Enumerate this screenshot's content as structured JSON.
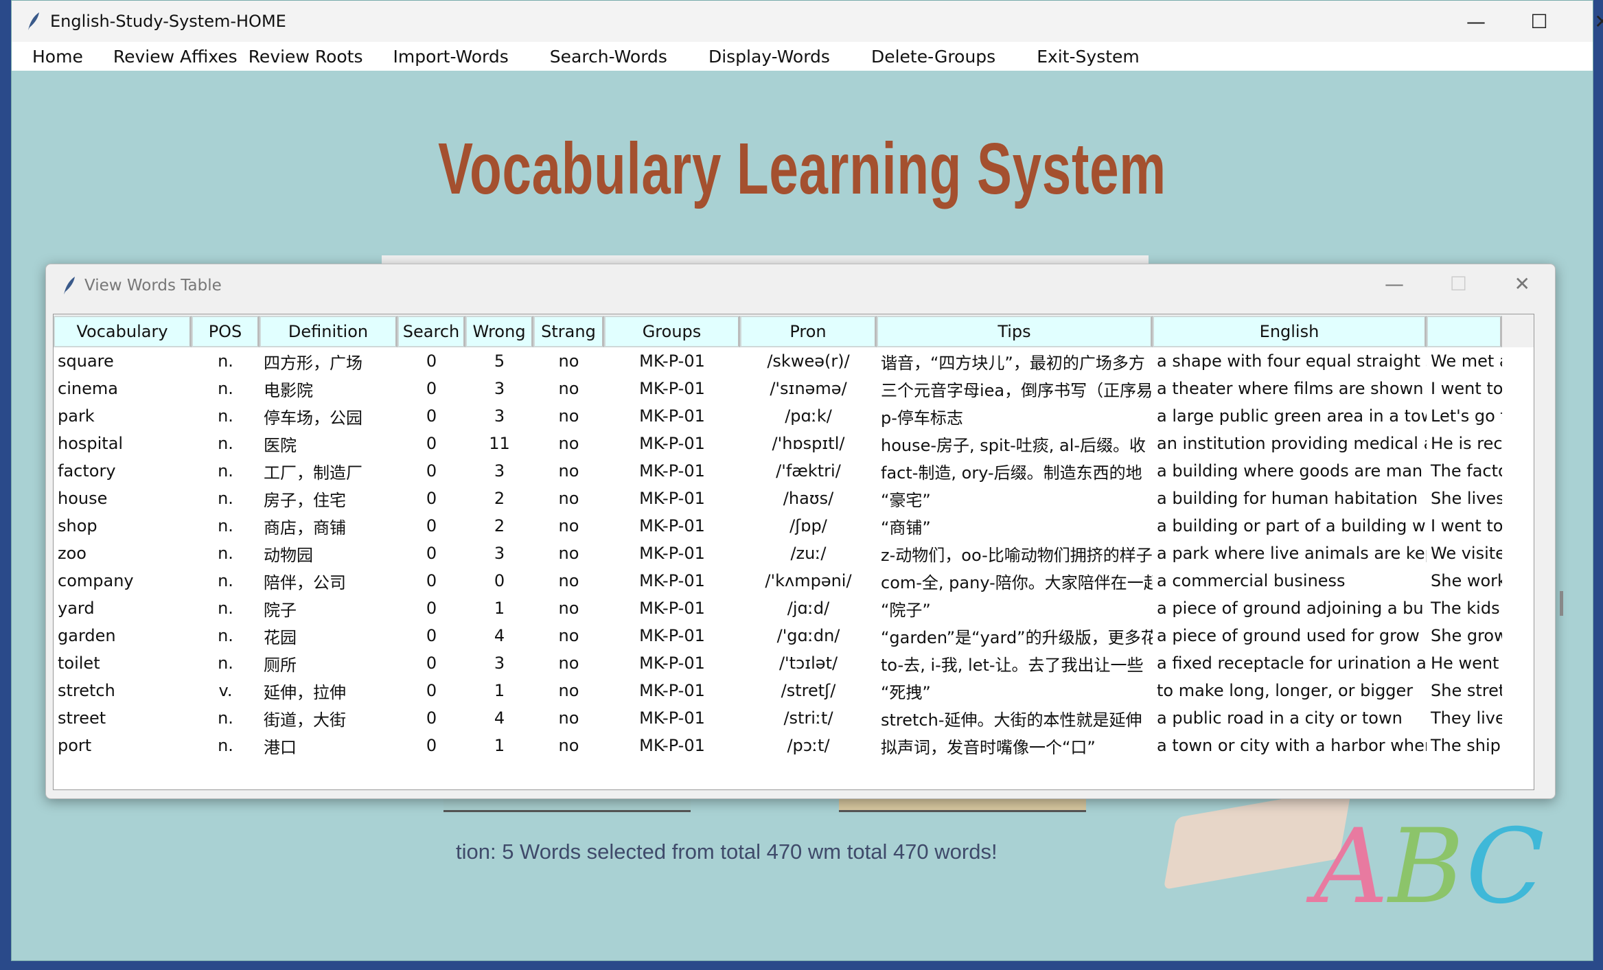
{
  "window": {
    "title": "English-Study-System-HOME",
    "icon": "feather-icon"
  },
  "menu": [
    "Home",
    "Review Affixes",
    "Review Roots",
    "Import-Words",
    "Search-Words",
    "Display-Words",
    "Delete-Groups",
    "Exit-System"
  ],
  "main": {
    "title": "Vocabulary Learning System",
    "status": "tion: 5 Words selected from total 470 wm total 470 words!",
    "logo": "ABC"
  },
  "colors": {
    "background": "#a9d1d3",
    "title": "#a4502f",
    "header": "#e1ffff"
  },
  "dialog": {
    "title": "View Words Table",
    "columns": [
      "Vocabulary",
      "POS",
      "Definition",
      "Search",
      "Wrong",
      "Strang",
      "Groups",
      "Pron",
      "Tips",
      "English",
      ""
    ],
    "rows": [
      [
        "square",
        "n.",
        "四方形，广场",
        "0",
        "5",
        "no",
        "MK-P-01",
        "/skweə(r)/",
        "谐音，“四方块儿”，最初的广场多方",
        "a shape with four equal straight s",
        "We met at th"
      ],
      [
        "cinema",
        "n.",
        "电影院",
        "0",
        "3",
        "no",
        "MK-P-01",
        "/'sɪnəmə/",
        "三个元音字母iea，倒序书写（正序易",
        "a theater where films are shown",
        "I went to the"
      ],
      [
        "park",
        "n.",
        "停车场，公园",
        "0",
        "3",
        "no",
        "MK-P-01",
        "/pɑːk/",
        "p-停车标志",
        "a large public green area in a tow",
        "Let's go for a"
      ],
      [
        "hospital",
        "n.",
        "医院",
        "0",
        "11",
        "no",
        "MK-P-01",
        "/'hɒspɪtl/",
        "house-房子, spit-吐痰, al-后缀。收",
        "an institution providing medical a",
        "He is recover"
      ],
      [
        "factory",
        "n.",
        "工厂，制造厂",
        "0",
        "3",
        "no",
        "MK-P-01",
        "/'fæktri/",
        "fact-制造, ory-后缀。制造东西的地",
        "a building where goods are man",
        "The factory p"
      ],
      [
        "house",
        "n.",
        "房子，住宅",
        "0",
        "2",
        "no",
        "MK-P-01",
        "/haʊs/",
        "“豪宅”",
        "a building for human habitation",
        "She lives in a"
      ],
      [
        "shop",
        "n.",
        "商店，商铺",
        "0",
        "2",
        "no",
        "MK-P-01",
        "/ʃɒp/",
        "“商铺”",
        "a building or part of a building w",
        "I went to the"
      ],
      [
        "zoo",
        "n.",
        "动物园",
        "0",
        "3",
        "no",
        "MK-P-01",
        "/zuː/",
        "z-动物们，oo-比喻动物们拥挤的样子",
        "a park where live animals are kep",
        "We visited th"
      ],
      [
        "company",
        "n.",
        "陪伴，公司",
        "0",
        "0",
        "no",
        "MK-P-01",
        "/'kʌmpəni/",
        "com-全, pany-陪你。大家陪伴在一起",
        "a commercial business",
        "She works fo"
      ],
      [
        "yard",
        "n.",
        "院子",
        "0",
        "1",
        "no",
        "MK-P-01",
        "/jɑːd/",
        "“院子”",
        "a piece of ground adjoining a bu",
        "The kids are"
      ],
      [
        "garden",
        "n.",
        "花园",
        "0",
        "4",
        "no",
        "MK-P-01",
        "/'gɑːdn/",
        "“garden”是“yard”的升级版，更多花",
        "a piece of ground used for grow",
        "She grows to"
      ],
      [
        "toilet",
        "n.",
        "厕所",
        "0",
        "3",
        "no",
        "MK-P-01",
        "/'tɔɪlət/",
        "to-去, i-我, let-让。去了我出让一些",
        "a fixed receptacle for urination ar",
        "He went to th"
      ],
      [
        "stretch",
        "v.",
        "延伸，拉伸",
        "0",
        "1",
        "no",
        "MK-P-01",
        "/stretʃ/",
        "“死拽”",
        "to make long, longer, or bigger",
        "She stretched"
      ],
      [
        "street",
        "n.",
        "街道，大街",
        "0",
        "4",
        "no",
        "MK-P-01",
        "/striːt/",
        "stretch-延伸。大街的本性就是延伸",
        "a public road in a city or town",
        "They live on a"
      ],
      [
        "port",
        "n.",
        "港口",
        "0",
        "1",
        "no",
        "MK-P-01",
        "/pɔːt/",
        "拟声词，发音时嘴像一个“口”",
        "a town or city with a harbor wher",
        "The ship arri"
      ]
    ]
  }
}
